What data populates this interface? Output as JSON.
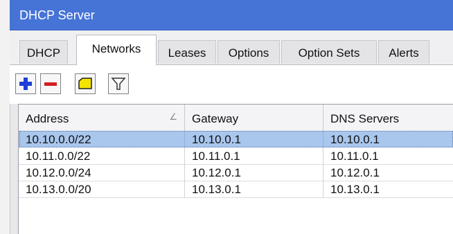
{
  "window": {
    "title": "DHCP Server"
  },
  "tabs": [
    {
      "label": "DHCP"
    },
    {
      "label": "Networks",
      "active": true
    },
    {
      "label": "Leases"
    },
    {
      "label": "Options"
    },
    {
      "label": "Option Sets"
    },
    {
      "label": "Alerts"
    }
  ],
  "toolbar": {
    "buttons": [
      {
        "icon": "plus-icon",
        "color": "#1f3fd6"
      },
      {
        "icon": "minus-icon",
        "color": "#d11f1f"
      },
      {
        "icon": "comment-icon",
        "color": "#f4e400"
      },
      {
        "icon": "filter-icon",
        "color": "#4a4a4a"
      }
    ]
  },
  "table": {
    "columns": [
      "Address",
      "Gateway",
      "DNS Servers"
    ],
    "sort_indicator": "∠",
    "rows": [
      {
        "address": "10.10.0.0/22",
        "gateway": "10.10.0.1",
        "dns": "10.10.0.1",
        "selected": true
      },
      {
        "address": "10.11.0.0/22",
        "gateway": "10.11.0.1",
        "dns": "10.11.0.1"
      },
      {
        "address": "10.12.0.0/24",
        "gateway": "10.12.0.1",
        "dns": "10.12.0.1"
      },
      {
        "address": "10.13.0.0/20",
        "gateway": "10.13.0.1",
        "dns": "10.13.0.1"
      }
    ]
  },
  "colors": {
    "title_bar": "#4673d6",
    "selected_row": "#a9c6ec"
  }
}
